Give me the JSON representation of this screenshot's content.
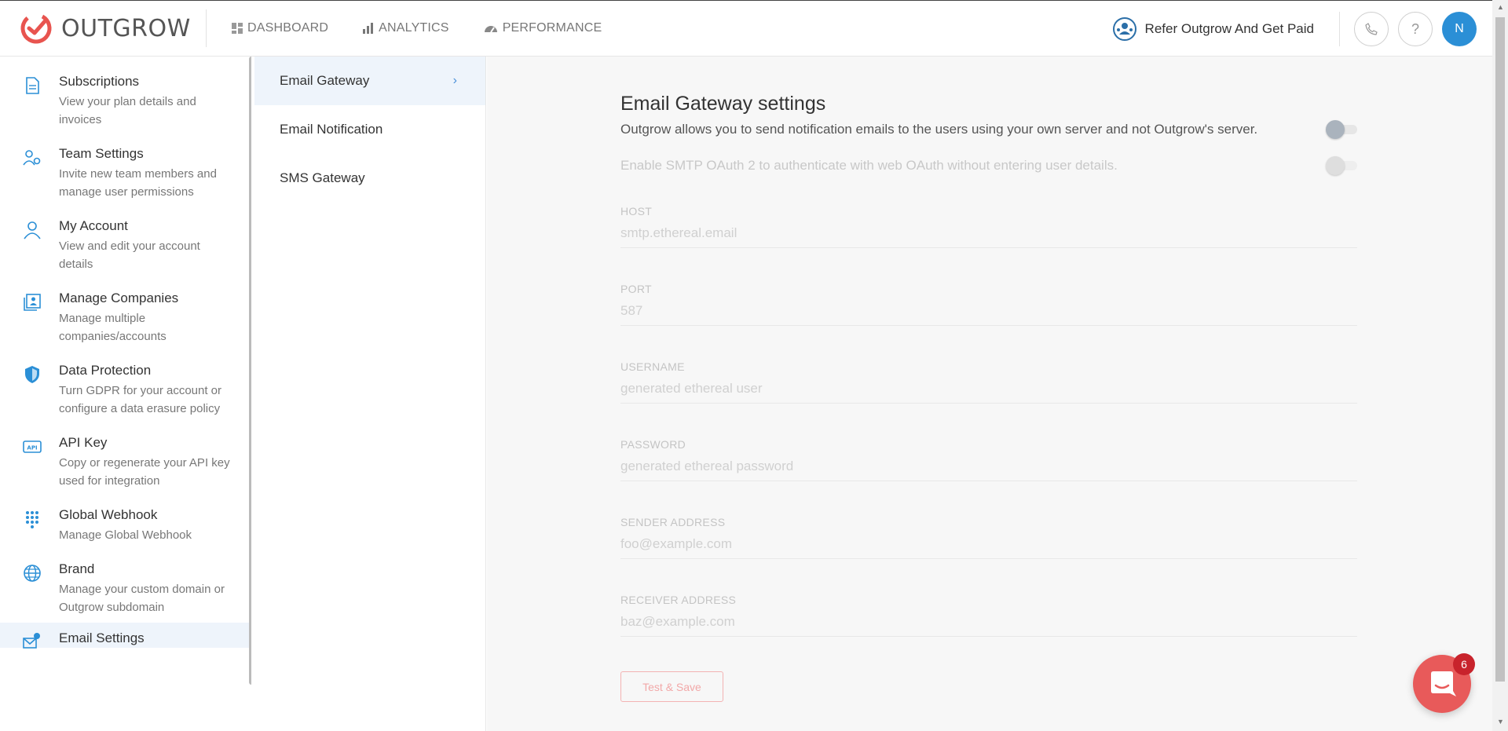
{
  "brand": {
    "name": "OUTGROW",
    "accent": "#e8544f"
  },
  "nav": [
    {
      "label": "DASHBOARD",
      "icon": "dashboard-icon"
    },
    {
      "label": "ANALYTICS",
      "icon": "bar-chart-icon"
    },
    {
      "label": "PERFORMANCE",
      "icon": "speedometer-icon"
    }
  ],
  "header": {
    "refer_label": "Refer Outgrow And Get Paid",
    "phone_icon": "phone-icon",
    "help_label": "?",
    "avatar_initial": "N",
    "avatar_color": "#2b8fd6"
  },
  "sidebar": {
    "items": [
      {
        "title": "Subscriptions",
        "desc": "View your plan details and invoices",
        "icon": "document-icon"
      },
      {
        "title": "Team Settings",
        "desc": "Invite new team members and manage user permissions",
        "icon": "team-settings-icon"
      },
      {
        "title": "My Account",
        "desc": "View and edit your account details",
        "icon": "user-icon"
      },
      {
        "title": "Manage Companies",
        "desc": "Manage multiple companies/accounts",
        "icon": "companies-icon"
      },
      {
        "title": "Data Protection",
        "desc": "Turn GDPR for your account or configure a data erasure policy",
        "icon": "shield-icon"
      },
      {
        "title": "API Key",
        "desc": "Copy or regenerate your API key used for integration",
        "icon": "api-icon"
      },
      {
        "title": "Global Webhook",
        "desc": "Manage Global Webhook",
        "icon": "webhook-grid-icon"
      },
      {
        "title": "Brand",
        "desc": "Manage your custom domain or Outgrow subdomain",
        "icon": "globe-icon"
      },
      {
        "title": "Email Settings",
        "desc": "",
        "icon": "email-settings-icon"
      }
    ]
  },
  "subnav": {
    "items": [
      {
        "label": "Email Gateway"
      },
      {
        "label": "Email Notification"
      },
      {
        "label": "SMS Gateway"
      }
    ]
  },
  "main": {
    "title": "Email Gateway settings",
    "toggle1_text": "Outgrow allows you to send notification emails to the users using your own server and not Outgrow's server.",
    "toggle2_text": "Enable SMTP OAuth 2 to authenticate with web OAuth without entering user details.",
    "fields": [
      {
        "label": "HOST",
        "placeholder": "smtp.ethereal.email"
      },
      {
        "label": "PORT",
        "placeholder": "587"
      },
      {
        "label": "USERNAME",
        "placeholder": "generated ethereal user"
      },
      {
        "label": "PASSWORD",
        "placeholder": "generated ethereal password"
      },
      {
        "label": "SENDER ADDRESS",
        "placeholder": "foo@example.com"
      },
      {
        "label": "RECEIVER ADDRESS",
        "placeholder": "baz@example.com"
      }
    ],
    "save_label": "Test & Save"
  },
  "chat": {
    "badge_count": "6",
    "color": "#e85a5a"
  }
}
